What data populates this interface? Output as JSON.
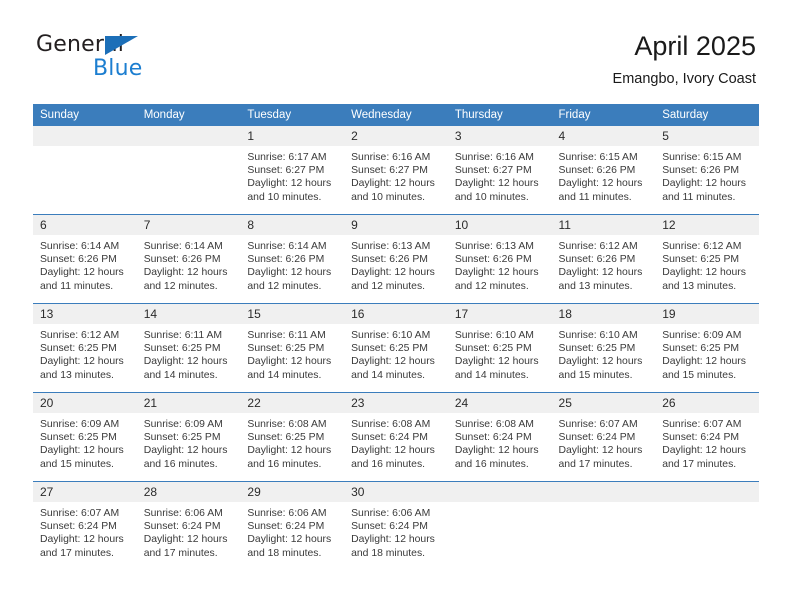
{
  "brand": {
    "name_part1": "General",
    "name_part2": "Blue",
    "triangle_icon": "triangle-logo-icon",
    "accent_color": "#1c7ed0"
  },
  "header": {
    "title": "April 2025",
    "subtitle": "Emangbo, Ivory Coast"
  },
  "colors": {
    "header_blue": "#3b7dbc",
    "daynum_band": "#f0f0f0",
    "text": "#3a3a3a"
  },
  "weekday_headers": [
    "Sunday",
    "Monday",
    "Tuesday",
    "Wednesday",
    "Thursday",
    "Friday",
    "Saturday"
  ],
  "weeks": [
    [
      {
        "day": "",
        "empty": true,
        "sunrise": "",
        "sunset": "",
        "daylight_line1": "",
        "daylight_line2": ""
      },
      {
        "day": "",
        "empty": true,
        "sunrise": "",
        "sunset": "",
        "daylight_line1": "",
        "daylight_line2": ""
      },
      {
        "day": "1",
        "sunrise": "Sunrise: 6:17 AM",
        "sunset": "Sunset: 6:27 PM",
        "daylight_line1": "Daylight: 12 hours",
        "daylight_line2": "and 10 minutes."
      },
      {
        "day": "2",
        "sunrise": "Sunrise: 6:16 AM",
        "sunset": "Sunset: 6:27 PM",
        "daylight_line1": "Daylight: 12 hours",
        "daylight_line2": "and 10 minutes."
      },
      {
        "day": "3",
        "sunrise": "Sunrise: 6:16 AM",
        "sunset": "Sunset: 6:27 PM",
        "daylight_line1": "Daylight: 12 hours",
        "daylight_line2": "and 10 minutes."
      },
      {
        "day": "4",
        "sunrise": "Sunrise: 6:15 AM",
        "sunset": "Sunset: 6:26 PM",
        "daylight_line1": "Daylight: 12 hours",
        "daylight_line2": "and 11 minutes."
      },
      {
        "day": "5",
        "sunrise": "Sunrise: 6:15 AM",
        "sunset": "Sunset: 6:26 PM",
        "daylight_line1": "Daylight: 12 hours",
        "daylight_line2": "and 11 minutes."
      }
    ],
    [
      {
        "day": "6",
        "sunrise": "Sunrise: 6:14 AM",
        "sunset": "Sunset: 6:26 PM",
        "daylight_line1": "Daylight: 12 hours",
        "daylight_line2": "and 11 minutes."
      },
      {
        "day": "7",
        "sunrise": "Sunrise: 6:14 AM",
        "sunset": "Sunset: 6:26 PM",
        "daylight_line1": "Daylight: 12 hours",
        "daylight_line2": "and 12 minutes."
      },
      {
        "day": "8",
        "sunrise": "Sunrise: 6:14 AM",
        "sunset": "Sunset: 6:26 PM",
        "daylight_line1": "Daylight: 12 hours",
        "daylight_line2": "and 12 minutes."
      },
      {
        "day": "9",
        "sunrise": "Sunrise: 6:13 AM",
        "sunset": "Sunset: 6:26 PM",
        "daylight_line1": "Daylight: 12 hours",
        "daylight_line2": "and 12 minutes."
      },
      {
        "day": "10",
        "sunrise": "Sunrise: 6:13 AM",
        "sunset": "Sunset: 6:26 PM",
        "daylight_line1": "Daylight: 12 hours",
        "daylight_line2": "and 12 minutes."
      },
      {
        "day": "11",
        "sunrise": "Sunrise: 6:12 AM",
        "sunset": "Sunset: 6:26 PM",
        "daylight_line1": "Daylight: 12 hours",
        "daylight_line2": "and 13 minutes."
      },
      {
        "day": "12",
        "sunrise": "Sunrise: 6:12 AM",
        "sunset": "Sunset: 6:25 PM",
        "daylight_line1": "Daylight: 12 hours",
        "daylight_line2": "and 13 minutes."
      }
    ],
    [
      {
        "day": "13",
        "sunrise": "Sunrise: 6:12 AM",
        "sunset": "Sunset: 6:25 PM",
        "daylight_line1": "Daylight: 12 hours",
        "daylight_line2": "and 13 minutes."
      },
      {
        "day": "14",
        "sunrise": "Sunrise: 6:11 AM",
        "sunset": "Sunset: 6:25 PM",
        "daylight_line1": "Daylight: 12 hours",
        "daylight_line2": "and 14 minutes."
      },
      {
        "day": "15",
        "sunrise": "Sunrise: 6:11 AM",
        "sunset": "Sunset: 6:25 PM",
        "daylight_line1": "Daylight: 12 hours",
        "daylight_line2": "and 14 minutes."
      },
      {
        "day": "16",
        "sunrise": "Sunrise: 6:10 AM",
        "sunset": "Sunset: 6:25 PM",
        "daylight_line1": "Daylight: 12 hours",
        "daylight_line2": "and 14 minutes."
      },
      {
        "day": "17",
        "sunrise": "Sunrise: 6:10 AM",
        "sunset": "Sunset: 6:25 PM",
        "daylight_line1": "Daylight: 12 hours",
        "daylight_line2": "and 14 minutes."
      },
      {
        "day": "18",
        "sunrise": "Sunrise: 6:10 AM",
        "sunset": "Sunset: 6:25 PM",
        "daylight_line1": "Daylight: 12 hours",
        "daylight_line2": "and 15 minutes."
      },
      {
        "day": "19",
        "sunrise": "Sunrise: 6:09 AM",
        "sunset": "Sunset: 6:25 PM",
        "daylight_line1": "Daylight: 12 hours",
        "daylight_line2": "and 15 minutes."
      }
    ],
    [
      {
        "day": "20",
        "sunrise": "Sunrise: 6:09 AM",
        "sunset": "Sunset: 6:25 PM",
        "daylight_line1": "Daylight: 12 hours",
        "daylight_line2": "and 15 minutes."
      },
      {
        "day": "21",
        "sunrise": "Sunrise: 6:09 AM",
        "sunset": "Sunset: 6:25 PM",
        "daylight_line1": "Daylight: 12 hours",
        "daylight_line2": "and 16 minutes."
      },
      {
        "day": "22",
        "sunrise": "Sunrise: 6:08 AM",
        "sunset": "Sunset: 6:25 PM",
        "daylight_line1": "Daylight: 12 hours",
        "daylight_line2": "and 16 minutes."
      },
      {
        "day": "23",
        "sunrise": "Sunrise: 6:08 AM",
        "sunset": "Sunset: 6:24 PM",
        "daylight_line1": "Daylight: 12 hours",
        "daylight_line2": "and 16 minutes."
      },
      {
        "day": "24",
        "sunrise": "Sunrise: 6:08 AM",
        "sunset": "Sunset: 6:24 PM",
        "daylight_line1": "Daylight: 12 hours",
        "daylight_line2": "and 16 minutes."
      },
      {
        "day": "25",
        "sunrise": "Sunrise: 6:07 AM",
        "sunset": "Sunset: 6:24 PM",
        "daylight_line1": "Daylight: 12 hours",
        "daylight_line2": "and 17 minutes."
      },
      {
        "day": "26",
        "sunrise": "Sunrise: 6:07 AM",
        "sunset": "Sunset: 6:24 PM",
        "daylight_line1": "Daylight: 12 hours",
        "daylight_line2": "and 17 minutes."
      }
    ],
    [
      {
        "day": "27",
        "sunrise": "Sunrise: 6:07 AM",
        "sunset": "Sunset: 6:24 PM",
        "daylight_line1": "Daylight: 12 hours",
        "daylight_line2": "and 17 minutes."
      },
      {
        "day": "28",
        "sunrise": "Sunrise: 6:06 AM",
        "sunset": "Sunset: 6:24 PM",
        "daylight_line1": "Daylight: 12 hours",
        "daylight_line2": "and 17 minutes."
      },
      {
        "day": "29",
        "sunrise": "Sunrise: 6:06 AM",
        "sunset": "Sunset: 6:24 PM",
        "daylight_line1": "Daylight: 12 hours",
        "daylight_line2": "and 18 minutes."
      },
      {
        "day": "30",
        "sunrise": "Sunrise: 6:06 AM",
        "sunset": "Sunset: 6:24 PM",
        "daylight_line1": "Daylight: 12 hours",
        "daylight_line2": "and 18 minutes."
      },
      {
        "day": "",
        "empty": true,
        "sunrise": "",
        "sunset": "",
        "daylight_line1": "",
        "daylight_line2": ""
      },
      {
        "day": "",
        "empty": true,
        "sunrise": "",
        "sunset": "",
        "daylight_line1": "",
        "daylight_line2": ""
      },
      {
        "day": "",
        "empty": true,
        "sunrise": "",
        "sunset": "",
        "daylight_line1": "",
        "daylight_line2": ""
      }
    ]
  ]
}
